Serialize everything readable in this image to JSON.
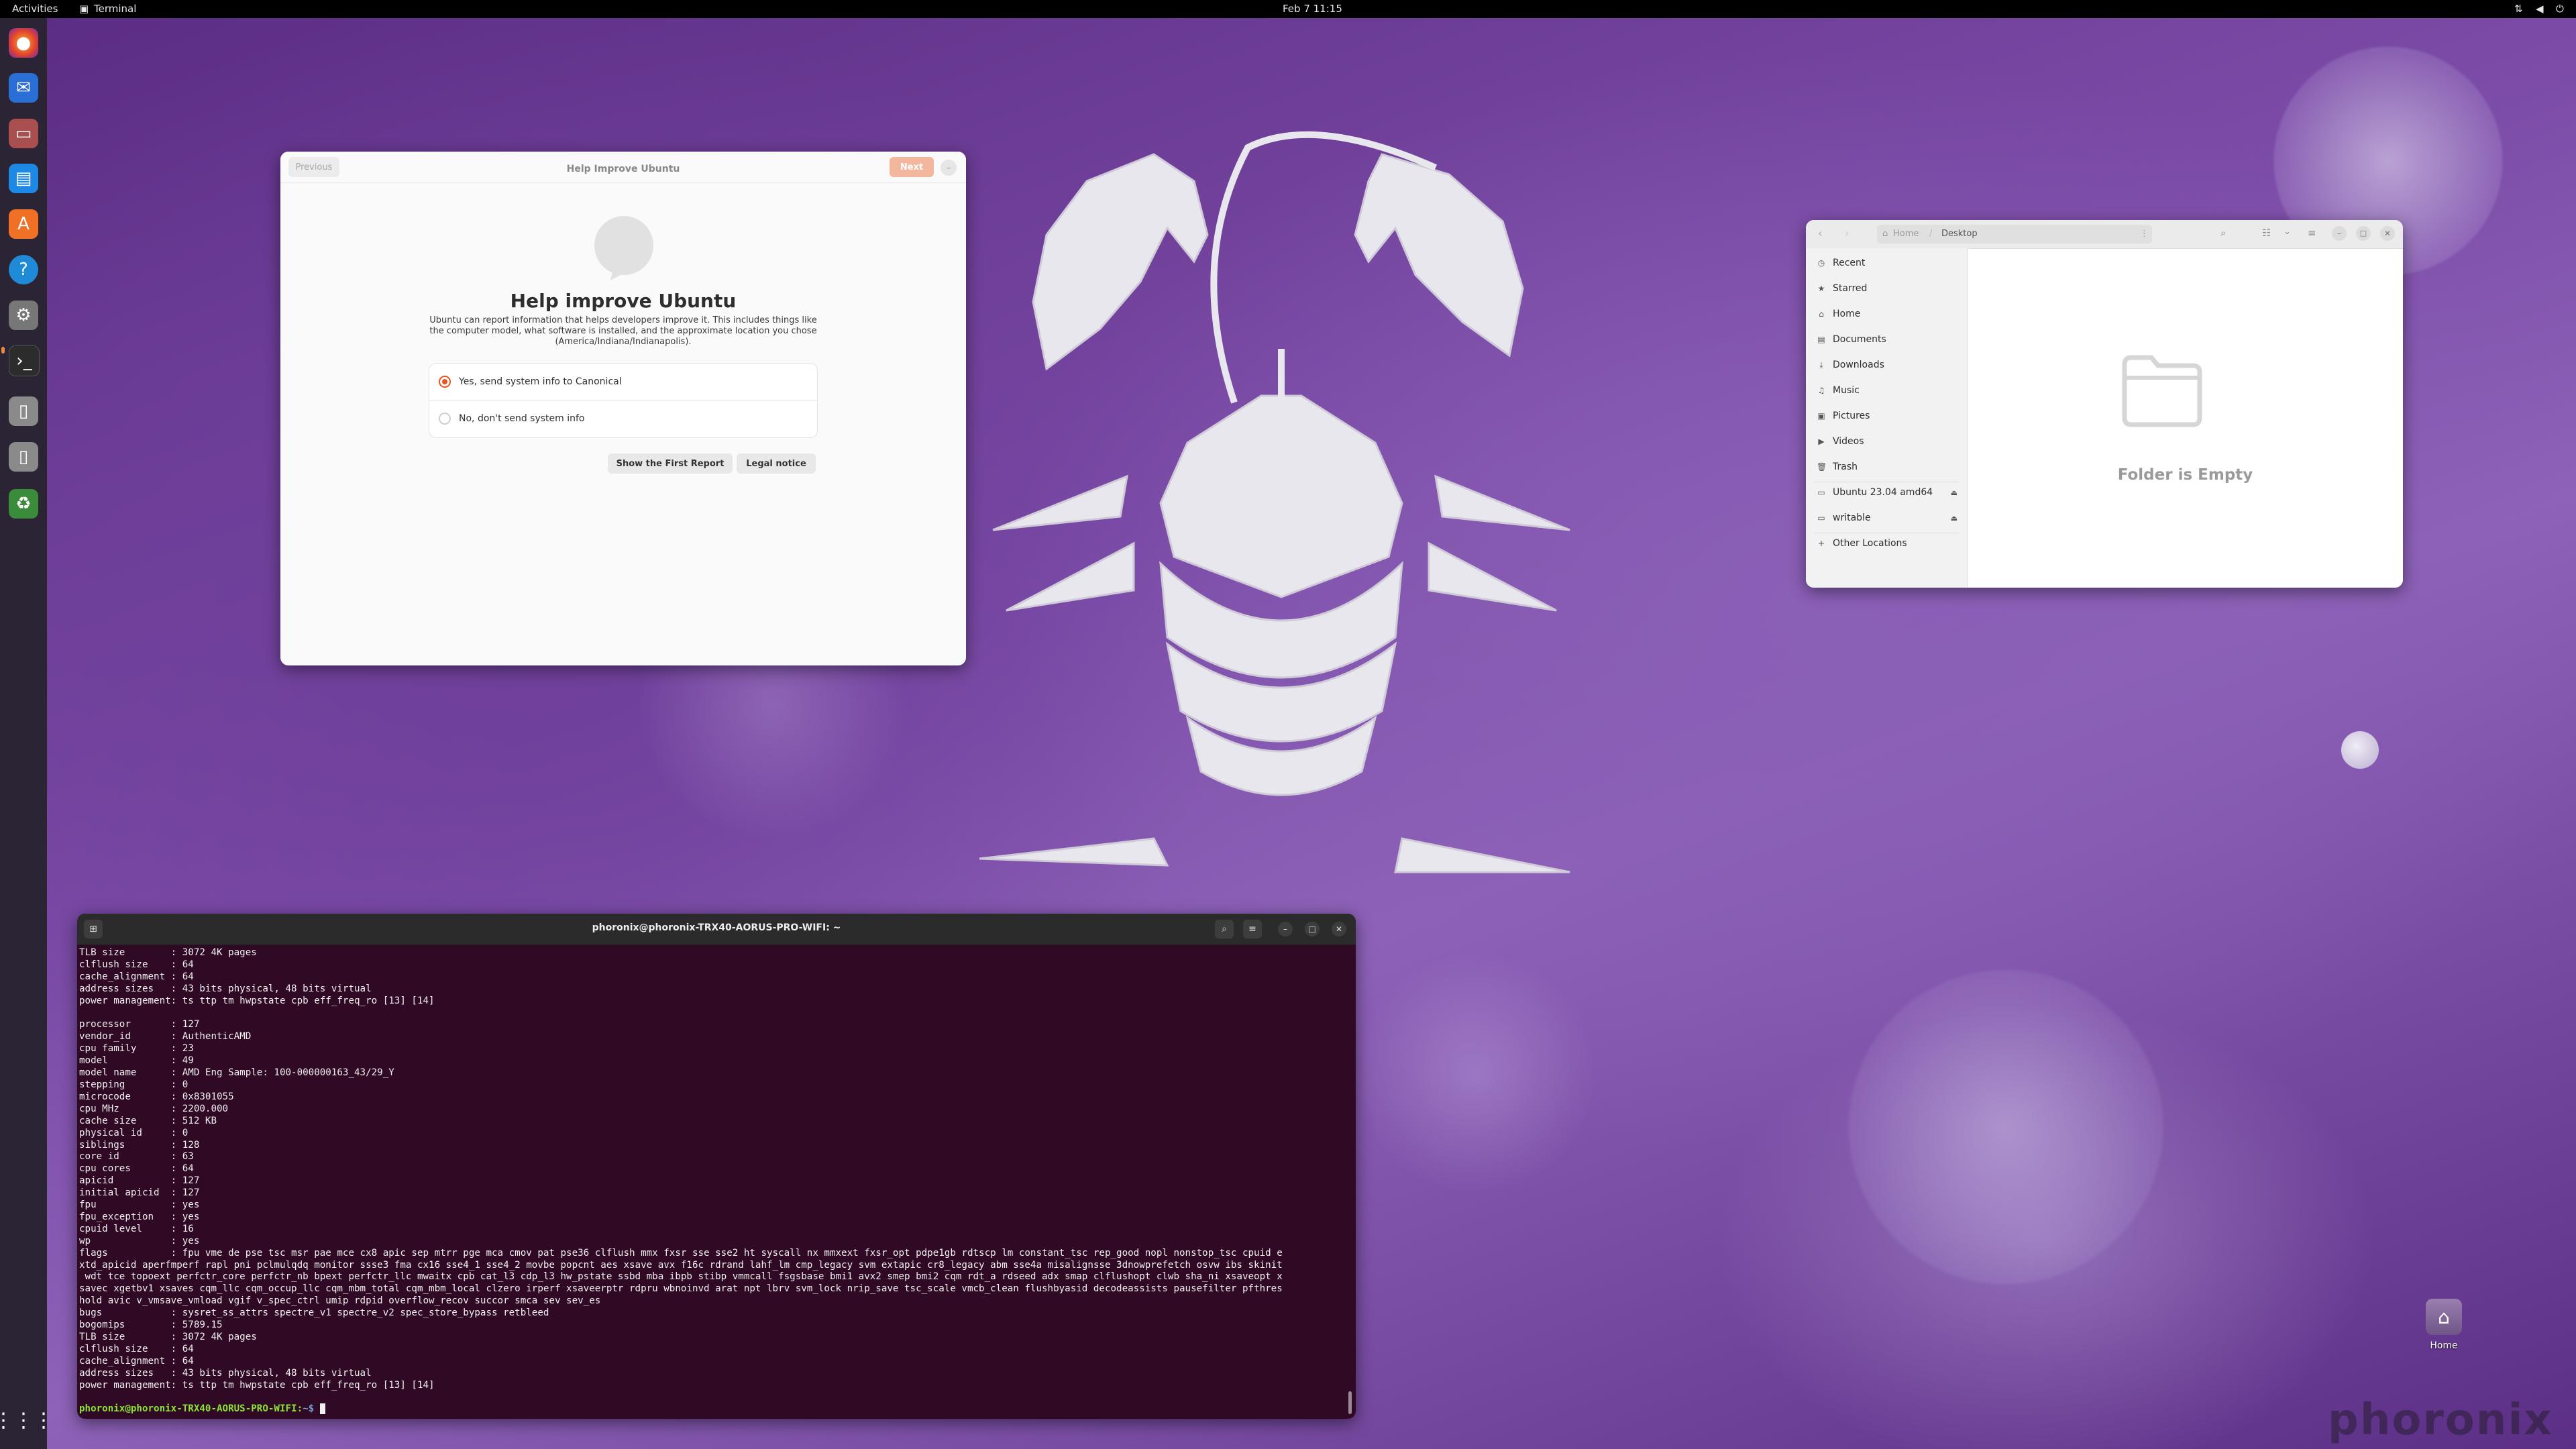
{
  "topbar": {
    "activities": "Activities",
    "app": "Terminal",
    "datetime": "Feb 7  11:15",
    "tray_icons": [
      "network-icon",
      "volume-icon",
      "power-icon"
    ]
  },
  "dock": {
    "apps": [
      "firefox-icon",
      "thunderbird-icon",
      "files-icon",
      "writer-icon",
      "software-icon",
      "help-icon",
      "settings-icon",
      "terminal-icon",
      "usb-drive-icon",
      "usb-drive-icon",
      "trash-icon"
    ],
    "grid_icon": "show-apps-icon"
  },
  "improve": {
    "previous": "Previous",
    "title": "Help Improve Ubuntu",
    "next": "Next",
    "heading": "Help improve Ubuntu",
    "description": "Ubuntu can report information that helps developers improve it. This includes things like the computer model, what software is installed, and the approximate location you chose (America/Indiana/Indianapolis).",
    "option_yes": "Yes, send system info to Canonical",
    "option_no": "No, don't send system info",
    "show_report": "Show the First Report",
    "legal": "Legal notice"
  },
  "files": {
    "path_home": "Home",
    "path_current": "Desktop",
    "sidebar": [
      "Recent",
      "Starred",
      "Home",
      "Documents",
      "Downloads",
      "Music",
      "Pictures",
      "Videos",
      "Trash"
    ],
    "sidebar_icons": [
      "clock-icon",
      "star-icon",
      "home-icon",
      "document-icon",
      "download-icon",
      "music-icon",
      "picture-icon",
      "video-icon",
      "trash-icon"
    ],
    "devices": [
      "Ubuntu 23.04 amd64",
      "writable"
    ],
    "other": "Other Locations",
    "empty": "Folder is Empty"
  },
  "terminal": {
    "title": "phoronix@phoronix-TRX40-AORUS-PRO-WIFI: ~",
    "lines": [
      "TLB size        : 3072 4K pages",
      "clflush size    : 64",
      "cache_alignment : 64",
      "address sizes   : 43 bits physical, 48 bits virtual",
      "power management: ts ttp tm hwpstate cpb eff_freq_ro [13] [14]",
      "",
      "processor       : 127",
      "vendor_id       : AuthenticAMD",
      "cpu family      : 23",
      "model           : 49",
      "model name      : AMD Eng Sample: 100-000000163_43/29_Y",
      "stepping        : 0",
      "microcode       : 0x8301055",
      "cpu MHz         : 2200.000",
      "cache size      : 512 KB",
      "physical id     : 0",
      "siblings        : 128",
      "core id         : 63",
      "cpu cores       : 64",
      "apicid          : 127",
      "initial apicid  : 127",
      "fpu             : yes",
      "fpu_exception   : yes",
      "cpuid level     : 16",
      "wp              : yes",
      "flags           : fpu vme de pse tsc msr pae mce cx8 apic sep mtrr pge mca cmov pat pse36 clflush mmx fxsr sse sse2 ht syscall nx mmxext fxsr_opt pdpe1gb rdtscp lm constant_tsc rep_good nopl nonstop_tsc cpuid e",
      "xtd_apicid aperfmperf rapl pni pclmulqdq monitor ssse3 fma cx16 sse4_1 sse4_2 movbe popcnt aes xsave avx f16c rdrand lahf_lm cmp_legacy svm extapic cr8_legacy abm sse4a misalignsse 3dnowprefetch osvw ibs skinit",
      " wdt tce topoext perfctr_core perfctr_nb bpext perfctr_llc mwaitx cpb cat_l3 cdp_l3 hw_pstate ssbd mba ibpb stibp vmmcall fsgsbase bmi1 avx2 smep bmi2 cqm rdt_a rdseed adx smap clflushopt clwb sha_ni xsaveopt x",
      "savec xgetbv1 xsaves cqm_llc cqm_occup_llc cqm_mbm_total cqm_mbm_local clzero irperf xsaveerptr rdpru wbnoinvd arat npt lbrv svm_lock nrip_save tsc_scale vmcb_clean flushbyasid decodeassists pausefilter pfthres",
      "hold avic v_vmsave_vmload vgif v_spec_ctrl umip rdpid overflow_recov succor smca sev sev_es",
      "bugs            : sysret_ss_attrs spectre_v1 spectre_v2 spec_store_bypass retbleed",
      "bogomips        : 5789.15",
      "TLB size        : 3072 4K pages",
      "clflush size    : 64",
      "cache_alignment : 64",
      "address sizes   : 43 bits physical, 48 bits virtual",
      "power management: ts ttp tm hwpstate cpb eff_freq_ro [13] [14]",
      ""
    ],
    "prompt": "phoronix@phoronix-TRX40-AORUS-PRO-WIFI:",
    "prompt_suffix": "~$ "
  },
  "desktop": {
    "home_label": "Home",
    "watermark": "phoronix"
  }
}
